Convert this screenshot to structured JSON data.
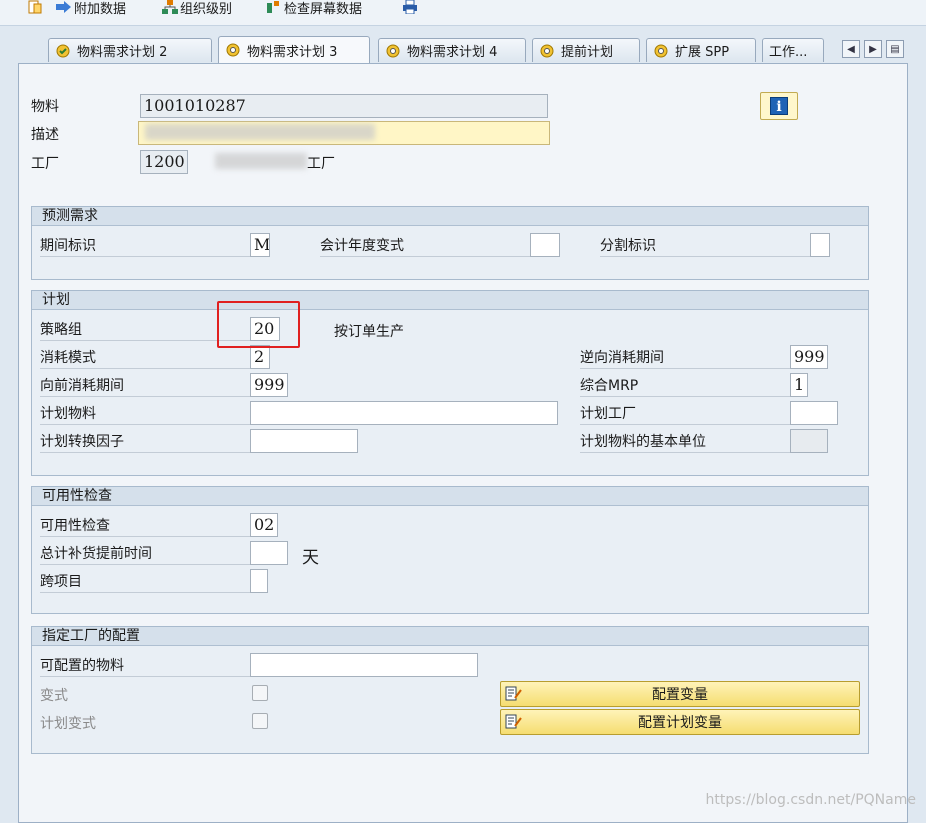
{
  "toolbar": {
    "items": [
      {
        "label": "",
        "icon": "new-document-icon"
      },
      {
        "label": "附加数据",
        "icon": "arrow-right-icon"
      },
      {
        "label": "组织级别",
        "icon": "org-hierarchy-icon"
      },
      {
        "label": "检查屏幕数据",
        "icon": "check-data-icon"
      },
      {
        "label": "",
        "icon": "printer-icon"
      }
    ]
  },
  "tabs": [
    {
      "label": "物料需求计划 2",
      "icon": "check-circle-icon"
    },
    {
      "label": "物料需求计划 3",
      "icon": "gear-icon"
    },
    {
      "label": "物料需求计划 4",
      "icon": "gear-icon"
    },
    {
      "label": "提前计划",
      "icon": "gear-icon"
    },
    {
      "label": "扩展 SPP",
      "icon": "gear-icon"
    },
    {
      "label": "工作..."
    }
  ],
  "header": {
    "material_label": "物料",
    "material_value": "1001010287",
    "description_label": "描述",
    "description_value": "",
    "plant_label": "工厂",
    "plant_value": "1200",
    "plant_name_suffix": "工厂"
  },
  "forecast": {
    "title": "预测需求",
    "period_indicator_label": "期间标识",
    "period_indicator_value": "M",
    "fiscal_year_variant_label": "会计年度变式",
    "fiscal_year_variant_value": "",
    "splitting_indicator_label": "分割标识",
    "splitting_indicator_value": ""
  },
  "planning": {
    "title": "计划",
    "strategy_group_label": "策略组",
    "strategy_group_value": "20",
    "strategy_group_desc": "按订单生产",
    "consumption_mode_label": "消耗模式",
    "consumption_mode_value": "2",
    "backward_period_label": "逆向消耗期间",
    "backward_period_value": "999",
    "forward_period_label": "向前消耗期间",
    "forward_period_value": "999",
    "mixed_mrp_label": "综合MRP",
    "mixed_mrp_value": "1",
    "planning_material_label": "计划物料",
    "planning_material_value": "",
    "planning_plant_label": "计划工厂",
    "planning_plant_value": "",
    "conversion_factor_label": "计划转换因子",
    "conversion_factor_value": "",
    "base_unit_label": "计划物料的基本单位",
    "base_unit_value": ""
  },
  "availability": {
    "title": "可用性检查",
    "check_label": "可用性检查",
    "check_value": "02",
    "total_lead_time_label": "总计补货提前时间",
    "total_lead_time_value": "",
    "total_lead_time_unit": "天",
    "cross_project_label": "跨项目",
    "cross_project_value": ""
  },
  "config": {
    "title": "指定工厂的配置",
    "configurable_material_label": "可配置的物料",
    "configurable_material_value": "",
    "variant_label": "变式",
    "planning_variant_label": "计划变式",
    "config_variant_button": "配置变量",
    "config_planning_variant_button": "配置计划变量"
  },
  "watermark": "https://blog.csdn.net/PQName",
  "colors": {
    "highlight_box": "#e02020",
    "button_yellow": "#f5dd70",
    "panel_bg": "#f2f5f9"
  }
}
